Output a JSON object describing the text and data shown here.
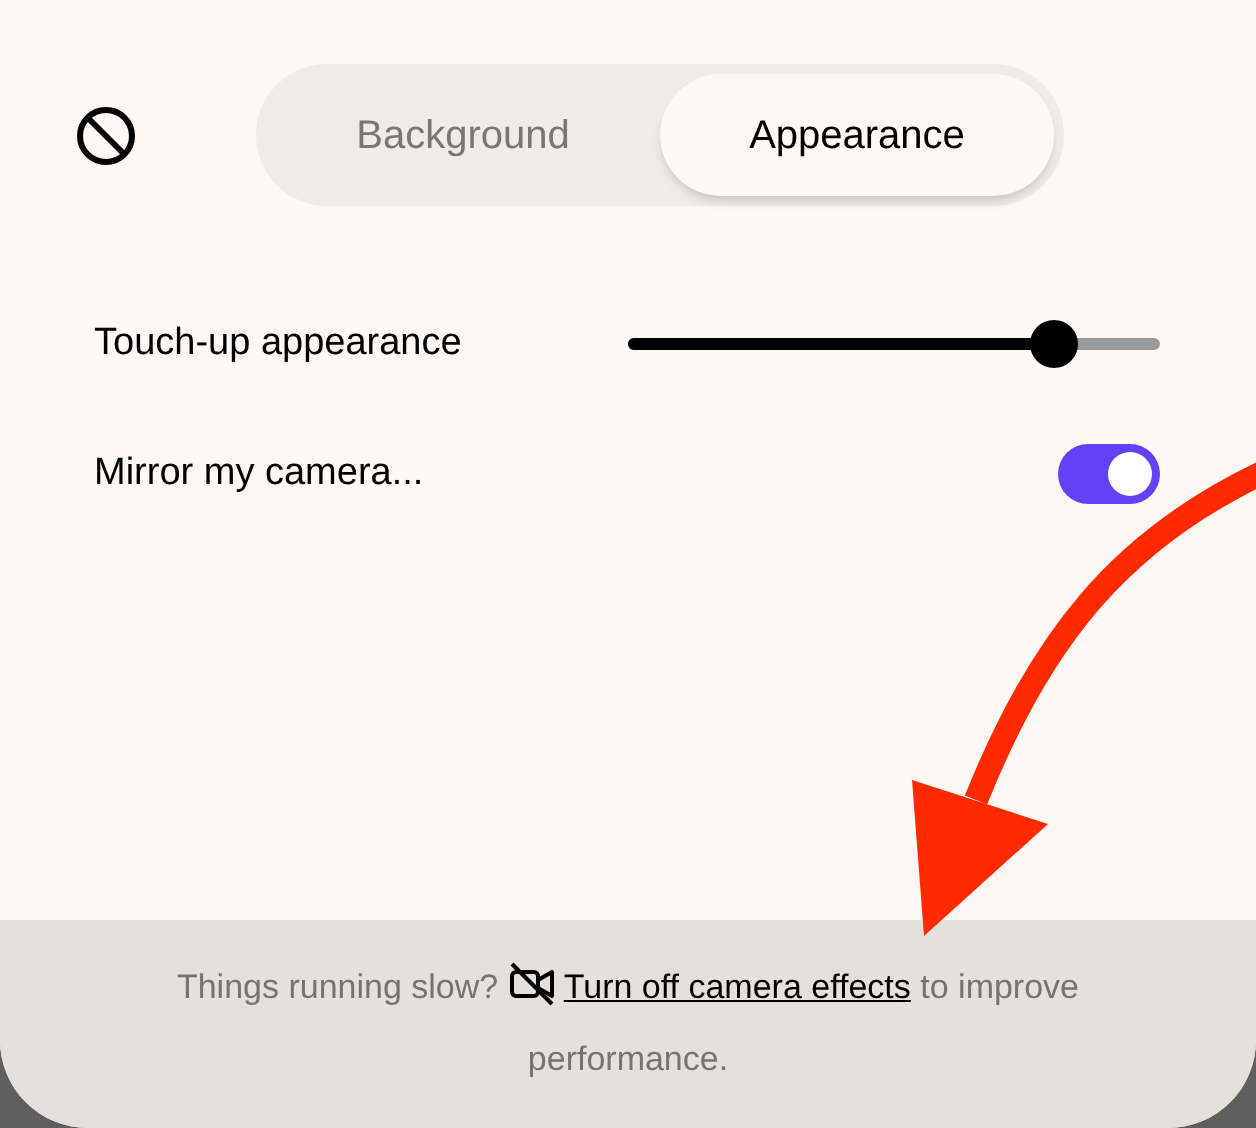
{
  "tabs": [
    {
      "label": "Background",
      "selected": false
    },
    {
      "label": "Appearance",
      "selected": true
    }
  ],
  "settings": [
    {
      "kind": "slider",
      "label": "Touch-up appearance",
      "level": 0.8
    },
    {
      "kind": "toggle",
      "label": "Mirror my camera...",
      "on": true
    }
  ],
  "footer": {
    "before": "Things running slow?",
    "link": "Turn off camera effects",
    "after": "to improve performance."
  }
}
